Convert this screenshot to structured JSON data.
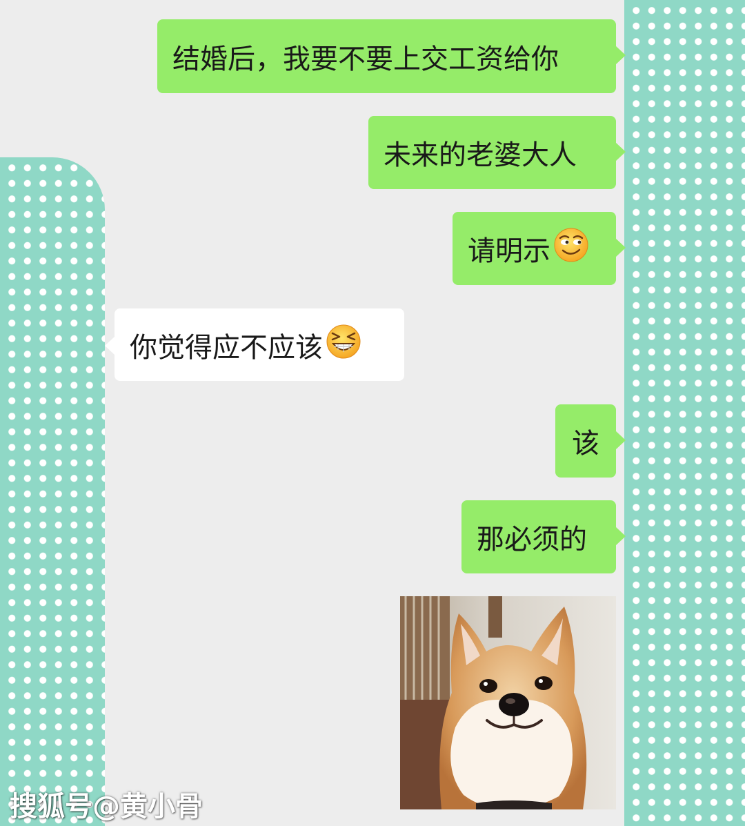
{
  "colors": {
    "chat_background": "#ededed",
    "sent_bubble": "#95ec69",
    "received_bubble": "#ffffff",
    "polka_dot_base": "#8fd8c6",
    "polka_dot": "#ffffff"
  },
  "messages": [
    {
      "side": "right",
      "text": "结婚后，我要不要上交工资给你"
    },
    {
      "side": "right",
      "text": "未来的老婆大人"
    },
    {
      "side": "right",
      "text": "请明示",
      "emoji": "smirk-emoji"
    },
    {
      "side": "left",
      "text": "你觉得应不应该",
      "emoji": "grin-squint-emoji"
    },
    {
      "side": "right",
      "text": "该"
    },
    {
      "side": "right",
      "text": "那必须的"
    },
    {
      "side": "right",
      "image": "shiba-inu-smiling-sticker"
    }
  ],
  "watermark": {
    "text": "搜狐号@黄小骨"
  }
}
